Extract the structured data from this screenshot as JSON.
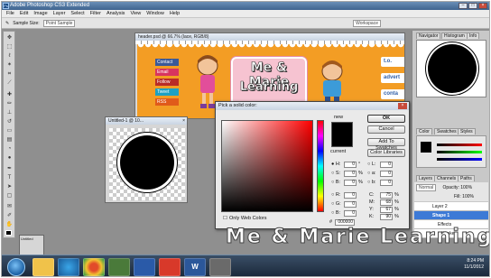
{
  "app": {
    "title": "Adobe Photoshop CS3 Extended",
    "icon_text": "Ps"
  },
  "menu": [
    "File",
    "Edit",
    "Image",
    "Layer",
    "Select",
    "Filter",
    "Analysis",
    "View",
    "Window",
    "Help"
  ],
  "options_bar": {
    "sample_size_label": "Sample Size:",
    "sample_size_value": "Point Sample",
    "workspace_label": "Workspace"
  },
  "document": {
    "tab_title": "header.psd @ 66.7% (lace, RGB/8)",
    "logo_line1": "Me & Marie",
    "logo_line2": "Learning",
    "nav_items": [
      "t.o.",
      "advert",
      "conta",
      "blog"
    ],
    "social_items": [
      "Contact",
      "Email",
      "Follow",
      "Tweet",
      "RSS"
    ]
  },
  "untitled_doc": {
    "title": "Untitled-1 @ 10..."
  },
  "color_picker": {
    "title": "Pick a solid color:",
    "new_label": "new",
    "current_label": "current",
    "ok": "OK",
    "cancel": "Cancel",
    "add_to_swatches": "Add To Swatches",
    "color_libraries": "Color Libraries",
    "only_web_colors": "Only Web Colors",
    "fields": {
      "H": "0",
      "S": "0",
      "B": "0",
      "R": "0",
      "G": "0",
      "B2": "0",
      "L": "0",
      "a": "0",
      "b": "0",
      "C": "75",
      "M": "68",
      "Y": "67",
      "K": "90",
      "hex": "000000"
    }
  },
  "right_panel": {
    "tabs_top": [
      "Navigator",
      "Histogram",
      "Info"
    ],
    "tabs_mid": [
      "Color",
      "Swatches",
      "Styles"
    ],
    "tabs_layers": [
      "Layers",
      "Channels",
      "Paths"
    ],
    "blend_mode": "Normal",
    "opacity_label": "Opacity:",
    "opacity_value": "100%",
    "fill_label": "Fill:",
    "fill_value": "100%",
    "layers": [
      "Layer 2",
      "Shape 1",
      "Effects",
      "Stroke"
    ]
  },
  "minidoc": {
    "label": "Untitled"
  },
  "taskbar": {
    "clock_time": "8:24 PM",
    "clock_date": "11/1/2012",
    "word_icon": "W"
  },
  "watermark": "Me  &  Marie  Learning",
  "colors": {
    "banner": "#f39d24",
    "pink": "#f6c3d1",
    "taskbar": "#182637"
  }
}
